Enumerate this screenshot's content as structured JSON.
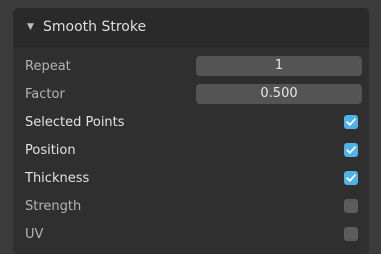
{
  "panel": {
    "title": "Smooth Stroke",
    "collapse_icon": "triangle-down-icon"
  },
  "fields": {
    "repeat": {
      "label": "Repeat",
      "value": "1"
    },
    "factor": {
      "label": "Factor",
      "value": "0.500"
    }
  },
  "options": [
    {
      "label": "Selected Points",
      "checked": true
    },
    {
      "label": "Position",
      "checked": true
    },
    {
      "label": "Thickness",
      "checked": true
    },
    {
      "label": "Strength",
      "checked": false
    },
    {
      "label": "UV",
      "checked": false
    }
  ],
  "colors": {
    "accent": "#4fb3e6",
    "panel_bg": "#2f2f2f",
    "field_bg": "#545454"
  }
}
